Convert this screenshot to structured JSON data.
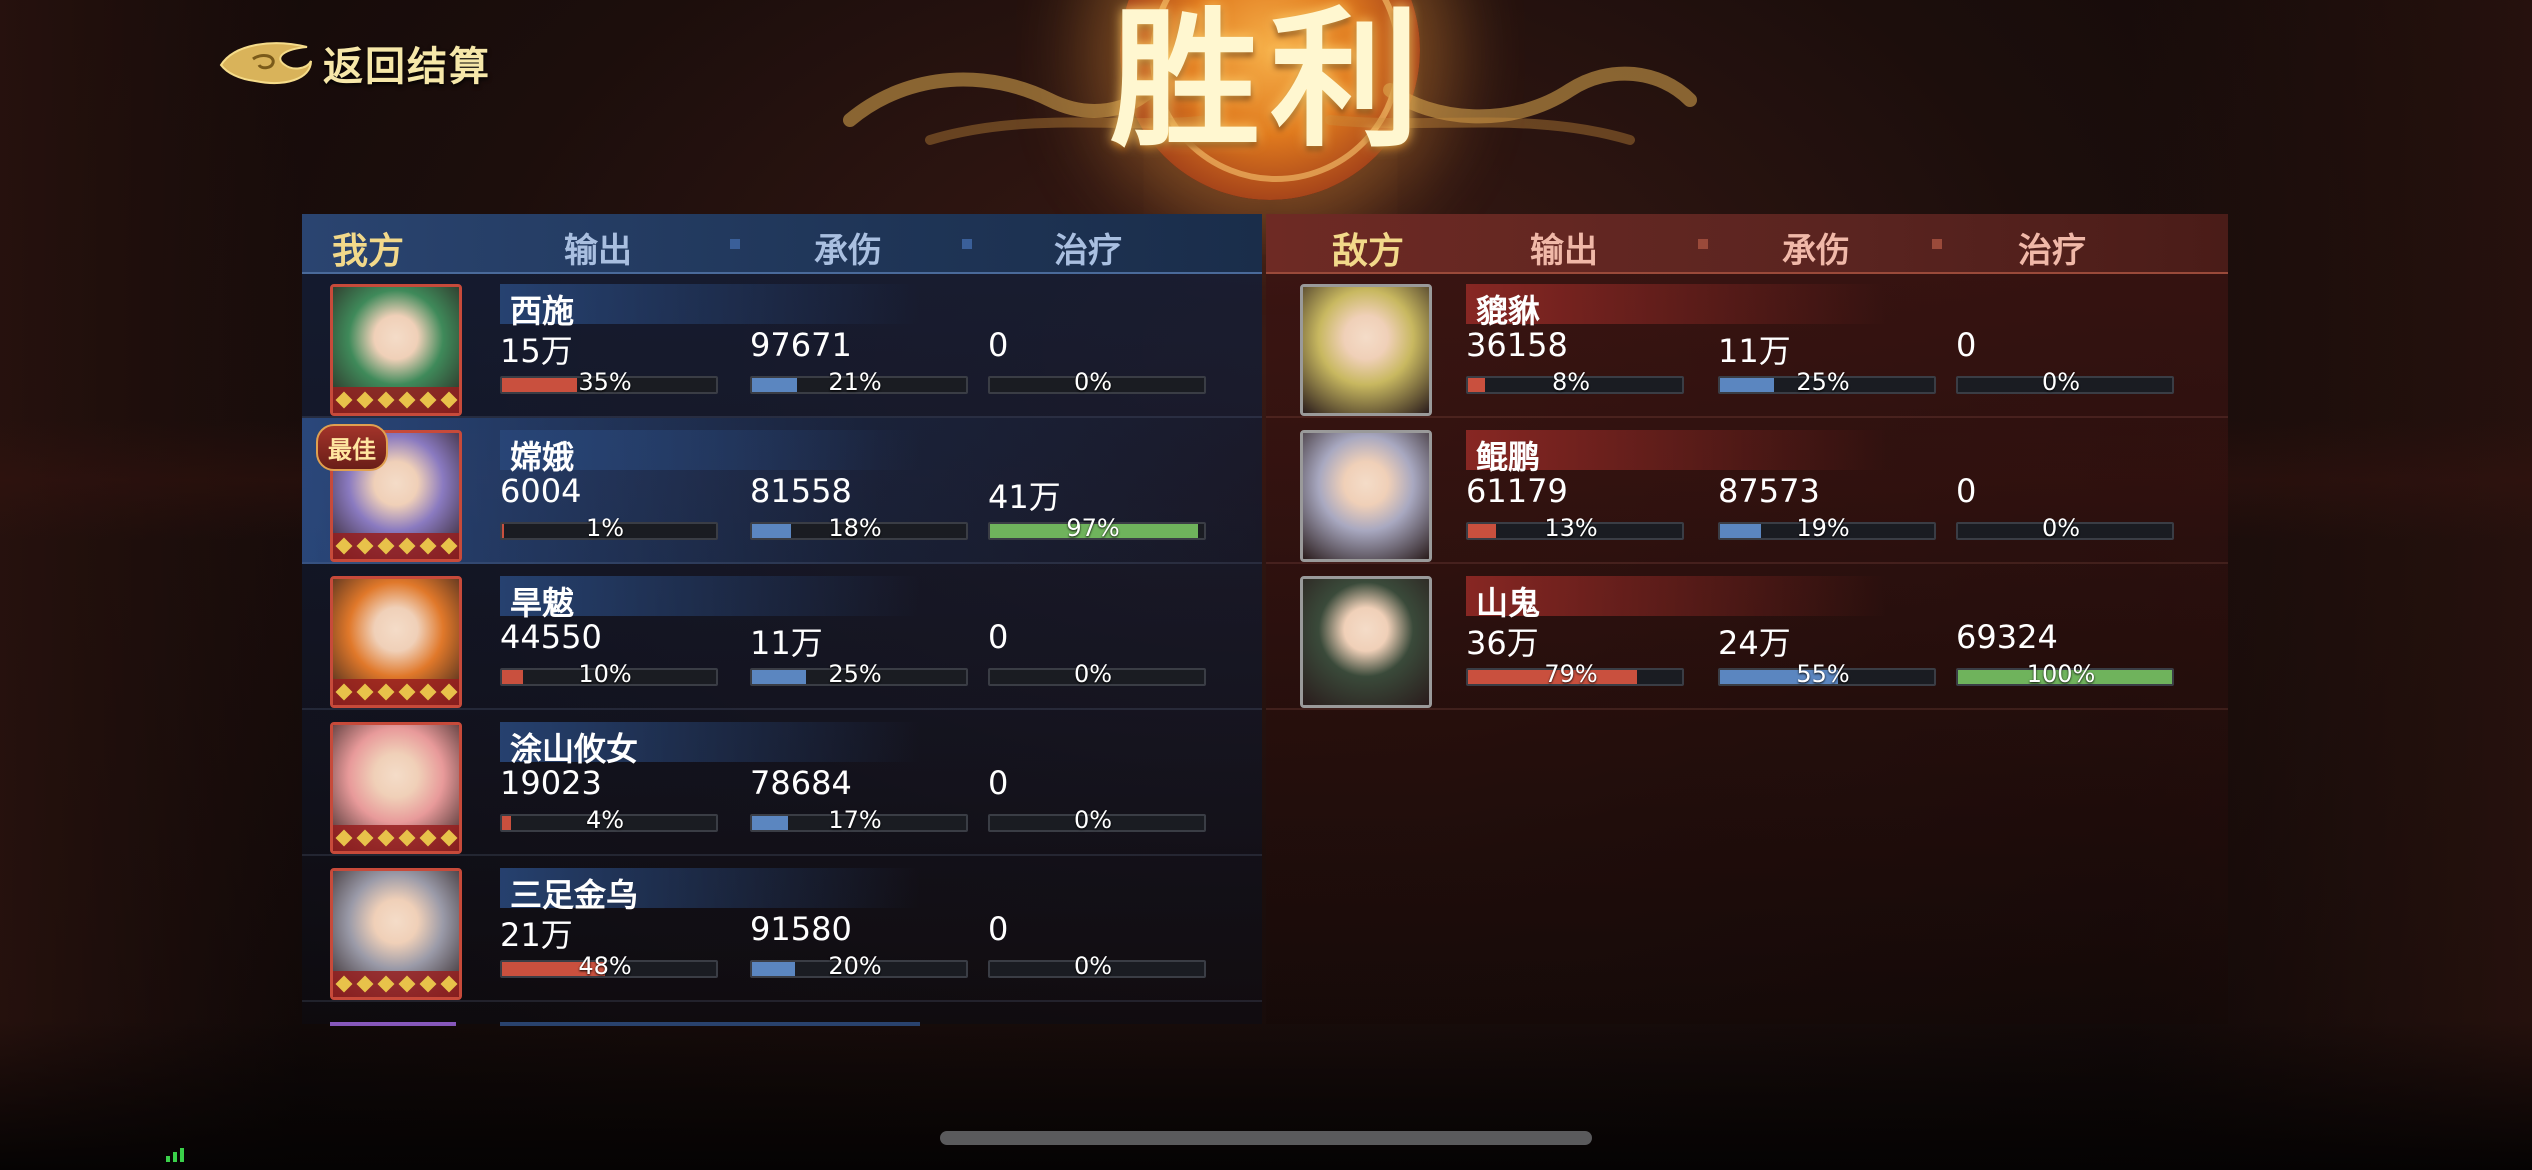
{
  "back": {
    "label": "返回结算"
  },
  "result": {
    "title": "胜利"
  },
  "ally": {
    "side": "我方",
    "columns": [
      "输出",
      "承伤",
      "治疗"
    ],
    "best_badge": "最佳",
    "rows": [
      {
        "name": "西施",
        "dmg": "15万",
        "dmg_pct": "35%",
        "dmg_frac": 0.35,
        "tank": "97671",
        "tank_pct": "21%",
        "tank_frac": 0.21,
        "heal": "0",
        "heal_pct": "0%",
        "heal_frac": 0,
        "best": false
      },
      {
        "name": "嫦娥",
        "dmg": "6004",
        "dmg_pct": "1%",
        "dmg_frac": 0.01,
        "tank": "81558",
        "tank_pct": "18%",
        "tank_frac": 0.18,
        "heal": "41万",
        "heal_pct": "97%",
        "heal_frac": 0.97,
        "best": true
      },
      {
        "name": "旱魃",
        "dmg": "44550",
        "dmg_pct": "10%",
        "dmg_frac": 0.1,
        "tank": "11万",
        "tank_pct": "25%",
        "tank_frac": 0.25,
        "heal": "0",
        "heal_pct": "0%",
        "heal_frac": 0,
        "best": false
      },
      {
        "name": "涂山攸女",
        "dmg": "19023",
        "dmg_pct": "4%",
        "dmg_frac": 0.04,
        "tank": "78684",
        "tank_pct": "17%",
        "tank_frac": 0.17,
        "heal": "0",
        "heal_pct": "0%",
        "heal_frac": 0,
        "best": false
      },
      {
        "name": "三足金乌",
        "dmg": "21万",
        "dmg_pct": "48%",
        "dmg_frac": 0.48,
        "tank": "91580",
        "tank_pct": "20%",
        "tank_frac": 0.2,
        "heal": "0",
        "heal_pct": "0%",
        "heal_frac": 0,
        "best": false
      }
    ]
  },
  "enemy": {
    "side": "敌方",
    "columns": [
      "输出",
      "承伤",
      "治疗"
    ],
    "rows": [
      {
        "name": "貔貅",
        "dmg": "36158",
        "dmg_pct": "8%",
        "dmg_frac": 0.08,
        "tank": "11万",
        "tank_pct": "25%",
        "tank_frac": 0.25,
        "heal": "0",
        "heal_pct": "0%",
        "heal_frac": 0
      },
      {
        "name": "鲲鹏",
        "dmg": "61179",
        "dmg_pct": "13%",
        "dmg_frac": 0.13,
        "tank": "87573",
        "tank_pct": "19%",
        "tank_frac": 0.19,
        "heal": "0",
        "heal_pct": "0%",
        "heal_frac": 0
      },
      {
        "name": "山鬼",
        "dmg": "36万",
        "dmg_pct": "79%",
        "dmg_frac": 0.79,
        "tank": "24万",
        "tank_pct": "55%",
        "tank_frac": 0.55,
        "heal": "69324",
        "heal_pct": "100%",
        "heal_frac": 1.0
      }
    ]
  },
  "colors": {
    "damage_bar": "#c9503e",
    "tank_bar": "#5b86c0",
    "heal_bar": "#6fb35c",
    "ally_header": "#2a4470",
    "enemy_header": "#6e2a24",
    "gold_text": "#f2d98a"
  },
  "portrait_tints": {
    "ally": [
      "#3f8a5a",
      "#8a7ac0",
      "#e0782a",
      "#e89a9a",
      "#9a9aa8"
    ],
    "enemy": [
      "#c8b860",
      "#a8a8c0",
      "#3a4a3a"
    ]
  }
}
